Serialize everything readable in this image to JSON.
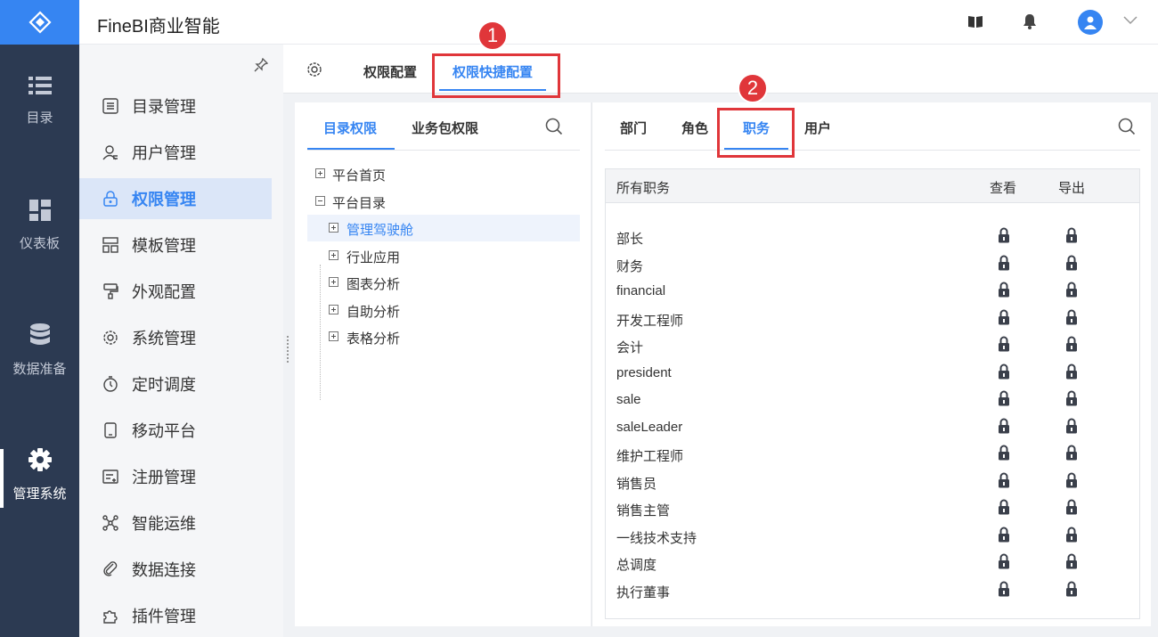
{
  "app": {
    "title": "FineBI商业智能"
  },
  "rail": {
    "items": [
      {
        "label": "目录",
        "icon": "list-icon"
      },
      {
        "label": "仪表板",
        "icon": "dashboard-icon"
      },
      {
        "label": "数据准备",
        "icon": "database-icon"
      },
      {
        "label": "管理系统",
        "icon": "gear-icon",
        "active": true
      }
    ]
  },
  "sidebar": {
    "items": [
      {
        "label": "目录管理",
        "icon": "catalog-icon"
      },
      {
        "label": "用户管理",
        "icon": "user-icon"
      },
      {
        "label": "权限管理",
        "icon": "lock-icon",
        "active": true
      },
      {
        "label": "模板管理",
        "icon": "template-icon"
      },
      {
        "label": "外观配置",
        "icon": "paint-roller-icon"
      },
      {
        "label": "系统管理",
        "icon": "settings-icon"
      },
      {
        "label": "定时调度",
        "icon": "timer-icon"
      },
      {
        "label": "移动平台",
        "icon": "mobile-icon"
      },
      {
        "label": "注册管理",
        "icon": "register-icon"
      },
      {
        "label": "智能运维",
        "icon": "network-icon"
      },
      {
        "label": "数据连接",
        "icon": "link-icon"
      },
      {
        "label": "插件管理",
        "icon": "puzzle-icon"
      }
    ]
  },
  "top_tabs": [
    {
      "label": "权限配置"
    },
    {
      "label": "权限快捷配置",
      "active": true
    }
  ],
  "left_panel": {
    "tabs": [
      {
        "label": "目录权限",
        "active": true
      },
      {
        "label": "业务包权限"
      }
    ],
    "tree": [
      {
        "label": "平台首页",
        "level": 0,
        "expanded": false
      },
      {
        "label": "平台目录",
        "level": 0,
        "expanded": true
      },
      {
        "label": "管理驾驶舱",
        "level": 1,
        "expanded": false,
        "selected": true
      },
      {
        "label": "行业应用",
        "level": 1,
        "expanded": false
      },
      {
        "label": "图表分析",
        "level": 1,
        "expanded": false
      },
      {
        "label": "自助分析",
        "level": 1,
        "expanded": false
      },
      {
        "label": "表格分析",
        "level": 1,
        "expanded": false
      }
    ]
  },
  "right_panel": {
    "tabs": [
      {
        "label": "部门"
      },
      {
        "label": "角色"
      },
      {
        "label": "职务",
        "active": true
      },
      {
        "label": "用户"
      }
    ],
    "table": {
      "headers": {
        "name": "所有职务",
        "view": "查看",
        "export": "导出"
      },
      "rows": [
        "部长",
        "财务",
        "financial",
        "开发工程师",
        "会计",
        "president",
        "sale",
        "saleLeader",
        "维护工程师",
        "销售员",
        "销售主管",
        "一线技术支持",
        "总调度",
        "执行董事"
      ]
    }
  },
  "annotations": [
    {
      "number": "1"
    },
    {
      "number": "2"
    }
  ],
  "colors": {
    "accent": "#3685f2",
    "rail": "#2c3a52",
    "annotation": "#e0363a"
  }
}
